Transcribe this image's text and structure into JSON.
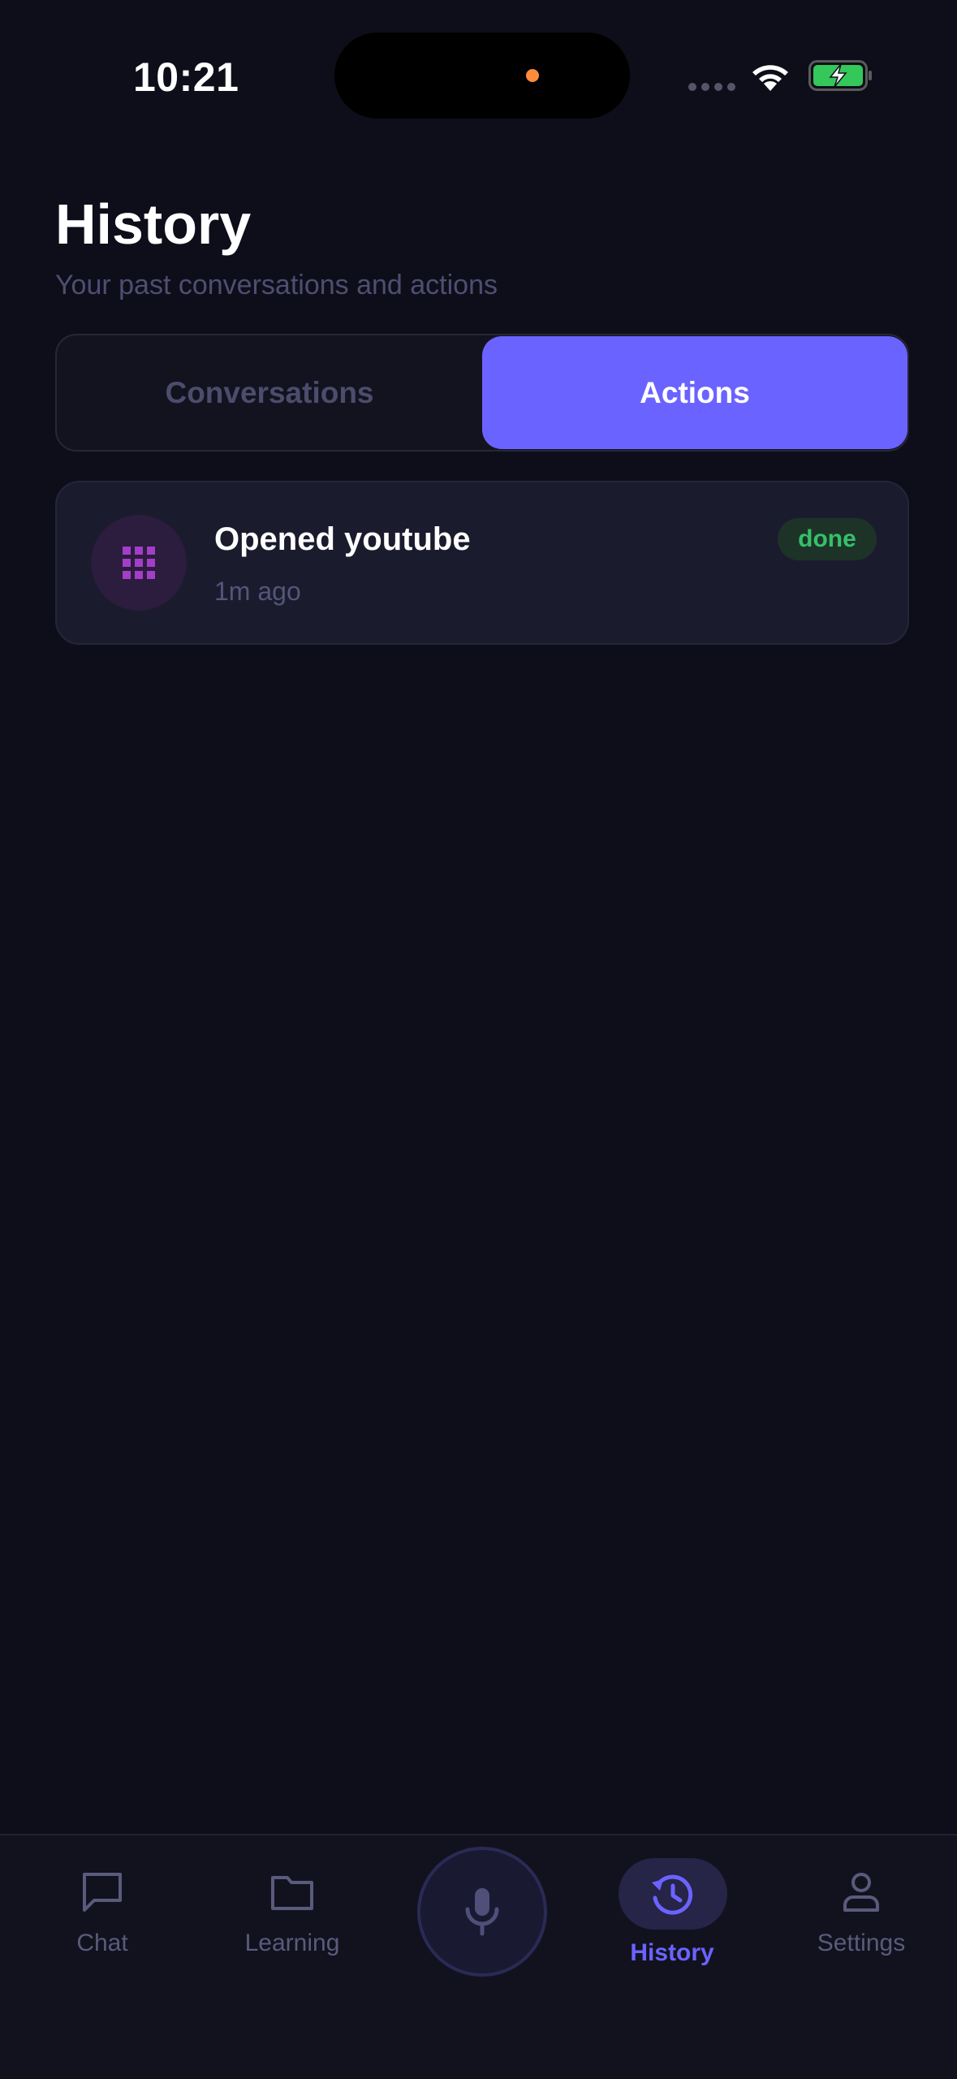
{
  "status_bar": {
    "time": "10:21",
    "island_dot_color": "#ff8c3a",
    "battery_color": "#34c759"
  },
  "header": {
    "title": "History",
    "subtitle": "Your past conversations and actions"
  },
  "tabs": [
    {
      "label": "Conversations",
      "selected": false
    },
    {
      "label": "Actions",
      "selected": true
    }
  ],
  "actions": [
    {
      "icon": "app-grid-icon",
      "title": "Opened youtube",
      "time": "1m ago",
      "status": "done"
    }
  ],
  "nav": {
    "items": [
      {
        "label": "Chat",
        "icon": "chat-bubble-icon"
      },
      {
        "label": "Learning",
        "icon": "folder-icon"
      },
      {
        "label": "",
        "icon": "microphone-icon"
      },
      {
        "label": "History",
        "icon": "history-clock-icon",
        "active": true
      },
      {
        "label": "Settings",
        "icon": "person-icon"
      }
    ]
  },
  "colors": {
    "background": "#0e0e1a",
    "accent": "#6b63ff",
    "success": "#35c06a",
    "muted_text": "#4e4e72"
  }
}
